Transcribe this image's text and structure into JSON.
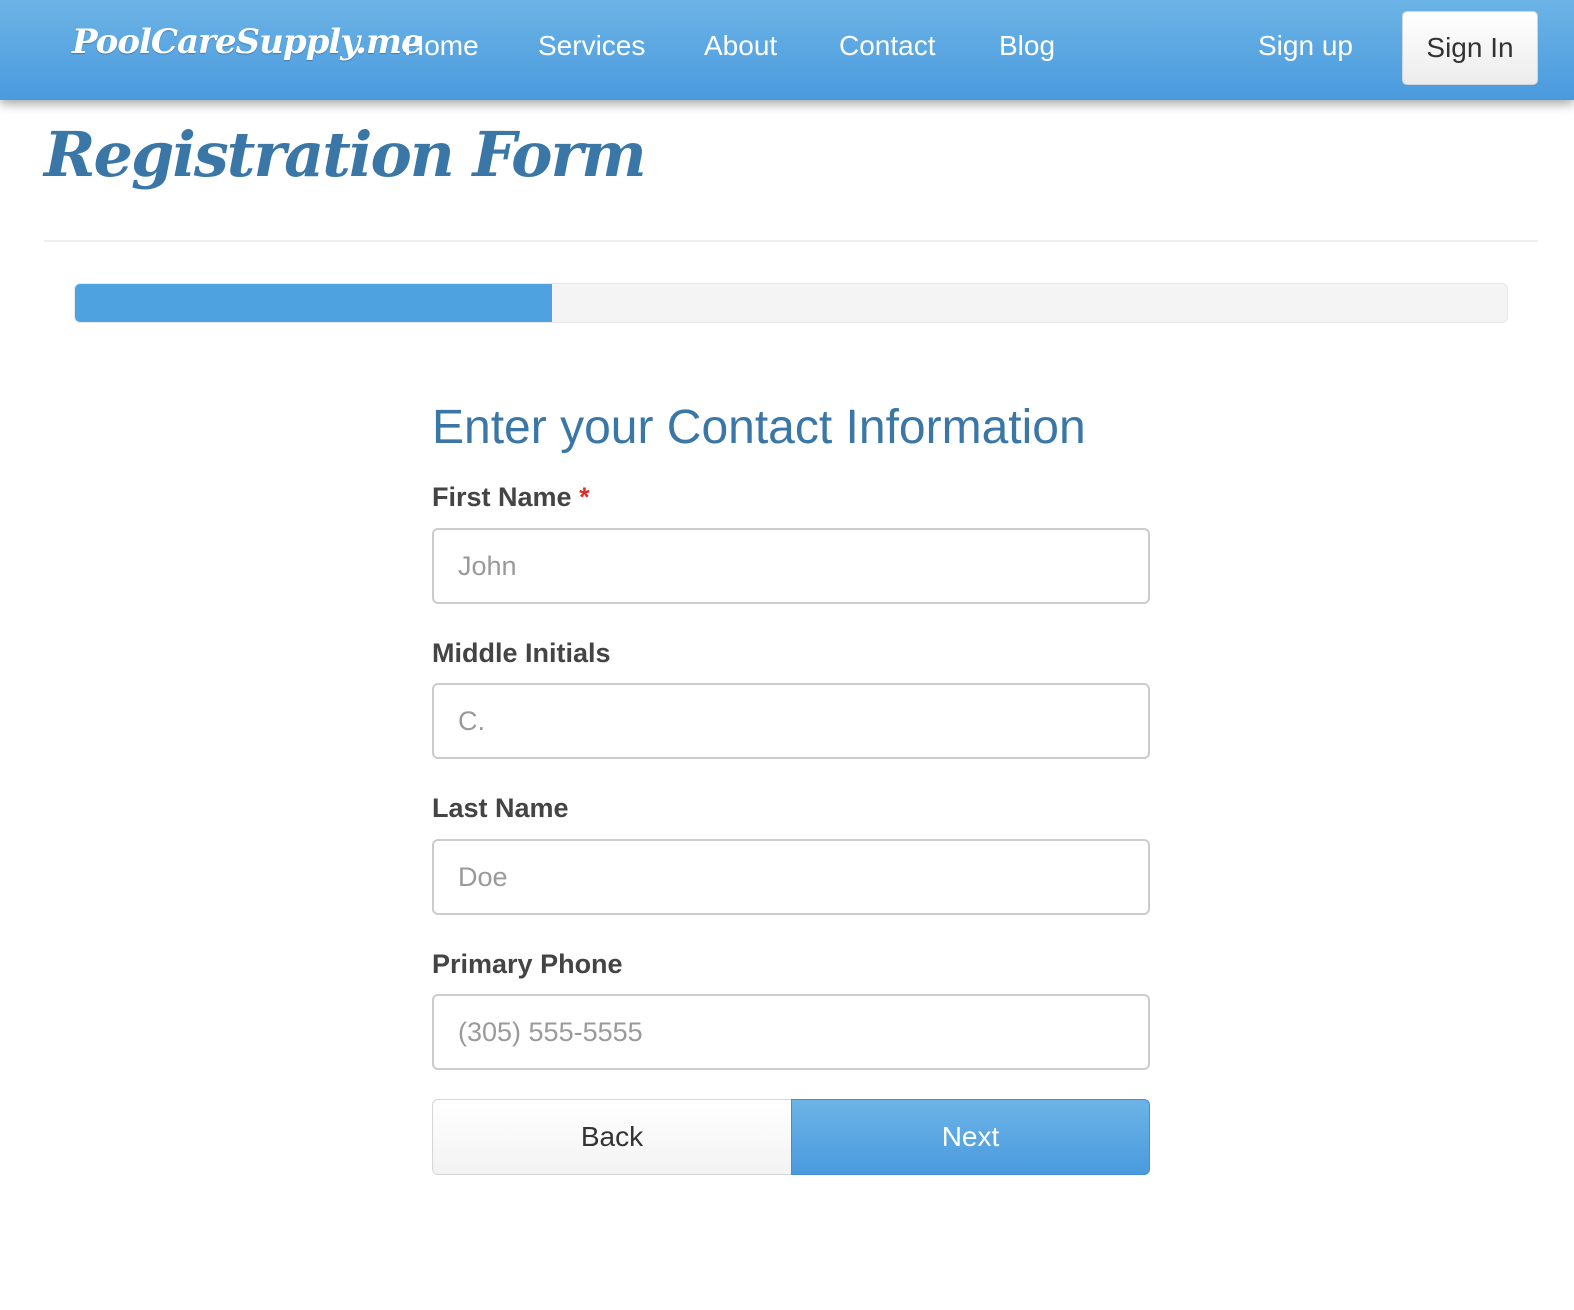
{
  "nav": {
    "brand": "PoolCareSupply.me",
    "links": [
      "Home",
      "Services",
      "About",
      "Contact",
      "Blog"
    ],
    "signup": "Sign up",
    "signin": "Sign In"
  },
  "page": {
    "title": "Registration Form"
  },
  "progress": {
    "percent": 33.3
  },
  "form": {
    "heading": "Enter your Contact Information",
    "required_marker": "*",
    "fields": {
      "first_name": {
        "label": "First Name",
        "placeholder": "John",
        "value": "",
        "required": true
      },
      "middle_initials": {
        "label": "Middle Initials",
        "placeholder": "C.",
        "value": ""
      },
      "last_name": {
        "label": "Last Name",
        "placeholder": "Doe",
        "value": ""
      },
      "primary_phone": {
        "label": "Primary Phone",
        "placeholder": "(305) 555-5555",
        "value": ""
      }
    },
    "back_label": "Back",
    "next_label": "Next"
  },
  "colors": {
    "nav_gradient_top": "#6cb4e6",
    "nav_gradient_bottom": "#4a9ade",
    "title_blue": "#3a77a6",
    "progress_fill": "#4fa2e0",
    "required_red": "#d9302b"
  }
}
